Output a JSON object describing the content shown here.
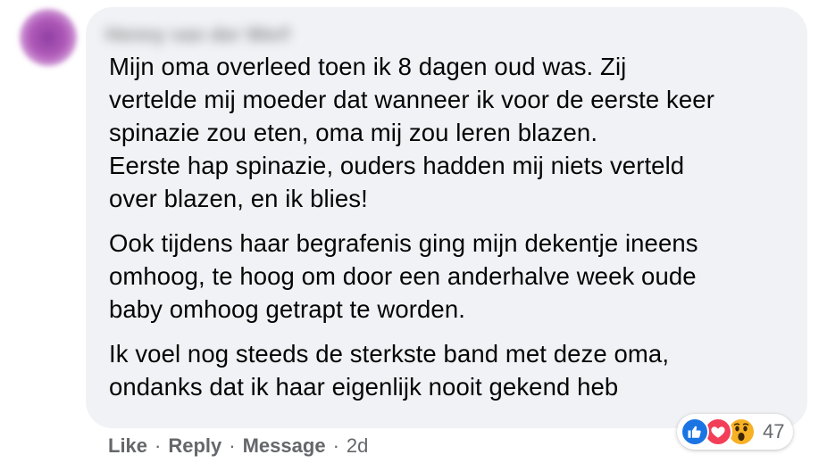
{
  "comment": {
    "author": "Henny van der Werf",
    "paragraphs": [
      "Mijn oma overleed toen ik 8 dagen oud was. Zij\nvertelde mij moeder dat wanneer ik voor de eerste keer\nspinazie zou eten, oma mij zou leren blazen.\nEerste hap spinazie, ouders hadden mij niets verteld\nover blazen, en ik blies!",
      "Ook tijdens haar begrafenis ging mijn dekentje ineens\nomhoog, te hoog om door een anderhalve week oude\nbaby omhoog getrapt te worden.",
      "Ik voel nog steeds de sterkste band met deze oma,\nondanks dat ik haar eigenlijk nooit gekend heb"
    ]
  },
  "actions": {
    "like": "Like",
    "reply": "Reply",
    "message": "Message",
    "separator": "·",
    "time": "2d"
  },
  "reactions": {
    "icons": [
      "like-icon",
      "love-icon",
      "wow-icon"
    ],
    "count": "47",
    "colors": {
      "like": "#1b74e4",
      "love": "#f33e58",
      "wow": "#f7b125"
    }
  },
  "colors": {
    "bubble": "#f0f2f5",
    "text": "#050505",
    "secondary_text": "#65676b",
    "avatar": "#a24bb3"
  }
}
